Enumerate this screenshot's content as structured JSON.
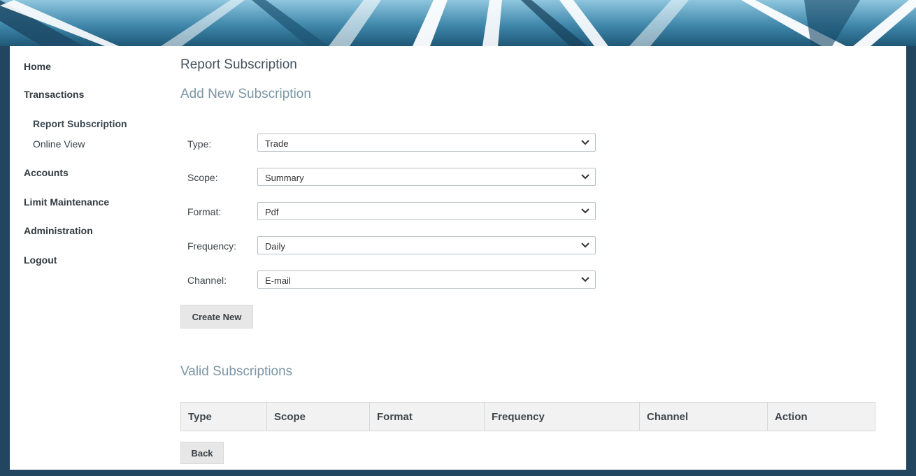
{
  "sidebar": {
    "home": "Home",
    "transactions": "Transactions",
    "report_subscription": "Report Subscription",
    "online_view": "Online View",
    "accounts": "Accounts",
    "limit_maintenance": "Limit Maintenance",
    "administration": "Administration",
    "logout": "Logout"
  },
  "page": {
    "title": "Report Subscription",
    "add_title": "Add New Subscription",
    "valid_title": "Valid Subscriptions"
  },
  "form": {
    "type_label": "Type:",
    "type_value": "Trade",
    "scope_label": "Scope:",
    "scope_value": "Summary",
    "format_label": "Format:",
    "format_value": "Pdf",
    "frequency_label": "Frequency:",
    "frequency_value": "Daily",
    "channel_label": "Channel:",
    "channel_value": "E-mail",
    "create_button": "Create New"
  },
  "table": {
    "headers": [
      "Type",
      "Scope",
      "Format",
      "Frequency",
      "Channel",
      "Action"
    ]
  },
  "back_button": "Back",
  "colors": {
    "frame": "#234660",
    "section_title": "#7c97a6"
  }
}
